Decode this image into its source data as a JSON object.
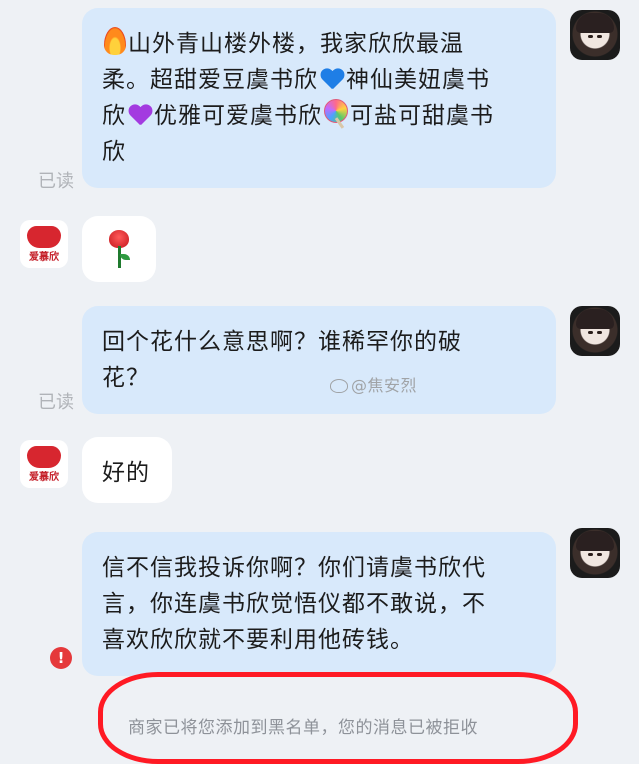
{
  "messages": [
    {
      "sender": "me",
      "text_before_fire": "",
      "line1": "山外青山楼外楼，我家欣欣最温",
      "line2a": "柔。超甜爱豆虞书欣",
      "line2b": "神仙美妞虞书",
      "line3a": "欣",
      "line3b": "优雅可爱虞书欣",
      "line3c": "可盐可甜虞书",
      "line4": "欣",
      "status": "已读"
    },
    {
      "sender": "shop",
      "content": "rose-emoji"
    },
    {
      "sender": "me",
      "line1": "回个花什么意思啊？谁稀罕你的破",
      "line2": "花？",
      "status": "已读"
    },
    {
      "sender": "shop",
      "text": "好的"
    },
    {
      "sender": "me",
      "line1": "信不信我投诉你啊？你们请虞书欣代",
      "line2": "言，你连虞书欣觉悟仪都不敢说，不",
      "line3": "喜欢欣欣就不要利用他砖钱。",
      "status_icon": "error-icon"
    }
  ],
  "shop_avatar_text": "爱慕欣",
  "watermark": "@焦安烈",
  "system_notice": "商家已将您添加到黑名单，您的消息已被拒收",
  "colors": {
    "my_bubble": "#d8e9fb",
    "their_bubble": "#ffffff",
    "background": "#eef1f5",
    "annotation_ring": "#ff1a24",
    "error": "#e5393b"
  }
}
